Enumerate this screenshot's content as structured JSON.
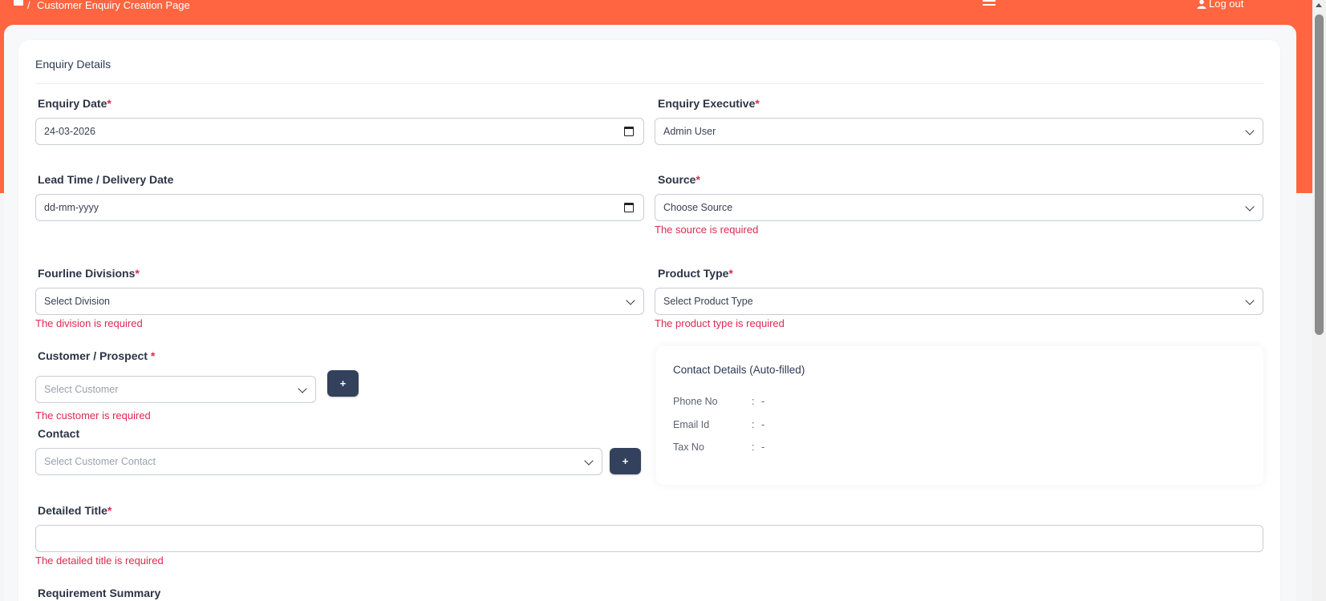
{
  "topbar": {
    "separator": "/",
    "breadcrumb": "Customer Enquiry Creation Page",
    "logout_label": "Log out"
  },
  "form": {
    "section_title": "Enquiry Details",
    "enquiry_date": {
      "label": "Enquiry Date",
      "value": "24-03-2026"
    },
    "enquiry_executive": {
      "label": "Enquiry Executive",
      "value": "Admin User"
    },
    "lead_time": {
      "label": "Lead Time / Delivery Date",
      "value": "dd-mm-yyyy"
    },
    "source": {
      "label": "Source",
      "value": "Choose Source",
      "error": "The source is required"
    },
    "divisions": {
      "label": "Fourline Divisions",
      "value": "Select Division",
      "error": "The division is required"
    },
    "product_type": {
      "label": "Product Type",
      "value": "Select Product Type",
      "error": "The product type is required"
    },
    "customer": {
      "label": "Customer / Prospect ",
      "placeholder": "Select Customer",
      "error": "The customer is required",
      "add_label": "+"
    },
    "contact": {
      "label": "Contact",
      "placeholder": "Select Customer Contact",
      "add_label": "+"
    },
    "detailed_title": {
      "label": "Detailed Title",
      "value": "",
      "error": "The detailed title is required"
    },
    "requirement_summary": {
      "label": "Requirement Summary"
    },
    "required_marker": "*"
  },
  "contact_details": {
    "title": "Contact Details (Auto-filled)",
    "colon": ":",
    "rows": [
      {
        "key": "Phone No",
        "value": "-"
      },
      {
        "key": "Email Id",
        "value": "-"
      },
      {
        "key": "Tax No",
        "value": "-"
      }
    ]
  },
  "colors": {
    "brand": "#fe6540",
    "button": "#33415c",
    "error": "#e0284f"
  }
}
